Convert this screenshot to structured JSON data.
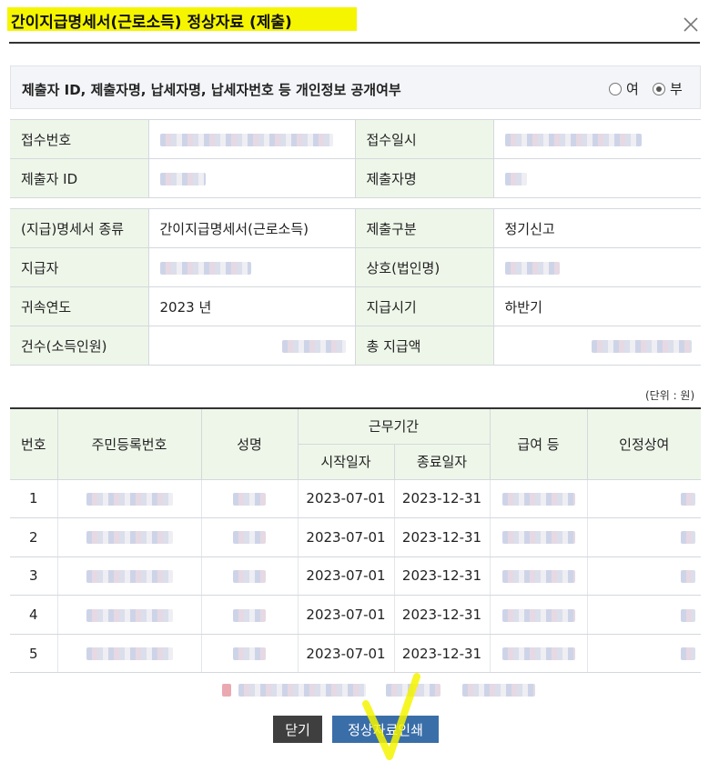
{
  "dialog": {
    "title": "간이지급명세서(근로소득) 정상자료 (제출)",
    "close_icon": "close-icon"
  },
  "privacy": {
    "label": "제출자 ID, 제출자명, 납세자명, 납세자번호 등 개인정보 공개여부",
    "options": [
      {
        "label": "여",
        "selected": false
      },
      {
        "label": "부",
        "selected": true
      }
    ]
  },
  "receipt": {
    "receipt_no_label": "접수번호",
    "receipt_date_label": "접수일시",
    "submitter_id_label": "제출자 ID",
    "submitter_name_label": "제출자명"
  },
  "statement": {
    "type_label": "(지급)명세서 종류",
    "type_value": "간이지급명세서(근로소득)",
    "category_label": "제출구분",
    "category_value": "정기신고",
    "payer_label": "지급자",
    "company_label": "상호(법인명)",
    "year_label": "귀속연도",
    "year_value": "2023 년",
    "period_label": "지급시기",
    "period_value": "하반기",
    "count_label": "건수(소득인원)",
    "total_label": "총 지급액"
  },
  "unit_note": "(단위 : 원)",
  "grid": {
    "headers": {
      "no": "번호",
      "rrn": "주민등록번호",
      "name": "성명",
      "work_period": "근무기간",
      "start": "시작일자",
      "end": "종료일자",
      "salary": "급여 등",
      "bonus": "인정상여"
    },
    "rows": [
      {
        "no": "1",
        "start": "2023-07-01",
        "end": "2023-12-31"
      },
      {
        "no": "2",
        "start": "2023-07-01",
        "end": "2023-12-31"
      },
      {
        "no": "3",
        "start": "2023-07-01",
        "end": "2023-12-31"
      },
      {
        "no": "4",
        "start": "2023-07-01",
        "end": "2023-12-31"
      },
      {
        "no": "5",
        "start": "2023-07-01",
        "end": "2023-12-31"
      }
    ]
  },
  "buttons": {
    "close": "닫기",
    "print": "정상자료인쇄"
  },
  "colors": {
    "highlight": "#f5f500",
    "label_bg": "#eef6e9",
    "print_button": "#3a6ea8",
    "close_button": "#3f3f3f"
  }
}
